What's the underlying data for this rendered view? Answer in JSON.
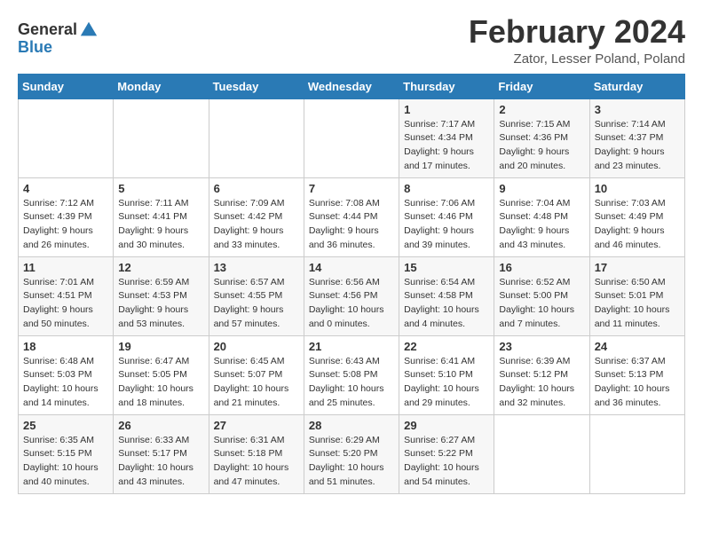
{
  "header": {
    "logo_general": "General",
    "logo_blue": "Blue",
    "title": "February 2024",
    "location": "Zator, Lesser Poland, Poland"
  },
  "days_of_week": [
    "Sunday",
    "Monday",
    "Tuesday",
    "Wednesday",
    "Thursday",
    "Friday",
    "Saturday"
  ],
  "weeks": [
    [
      {
        "day": "",
        "detail": ""
      },
      {
        "day": "",
        "detail": ""
      },
      {
        "day": "",
        "detail": ""
      },
      {
        "day": "",
        "detail": ""
      },
      {
        "day": "1",
        "detail": "Sunrise: 7:17 AM\nSunset: 4:34 PM\nDaylight: 9 hours\nand 17 minutes."
      },
      {
        "day": "2",
        "detail": "Sunrise: 7:15 AM\nSunset: 4:36 PM\nDaylight: 9 hours\nand 20 minutes."
      },
      {
        "day": "3",
        "detail": "Sunrise: 7:14 AM\nSunset: 4:37 PM\nDaylight: 9 hours\nand 23 minutes."
      }
    ],
    [
      {
        "day": "4",
        "detail": "Sunrise: 7:12 AM\nSunset: 4:39 PM\nDaylight: 9 hours\nand 26 minutes."
      },
      {
        "day": "5",
        "detail": "Sunrise: 7:11 AM\nSunset: 4:41 PM\nDaylight: 9 hours\nand 30 minutes."
      },
      {
        "day": "6",
        "detail": "Sunrise: 7:09 AM\nSunset: 4:42 PM\nDaylight: 9 hours\nand 33 minutes."
      },
      {
        "day": "7",
        "detail": "Sunrise: 7:08 AM\nSunset: 4:44 PM\nDaylight: 9 hours\nand 36 minutes."
      },
      {
        "day": "8",
        "detail": "Sunrise: 7:06 AM\nSunset: 4:46 PM\nDaylight: 9 hours\nand 39 minutes."
      },
      {
        "day": "9",
        "detail": "Sunrise: 7:04 AM\nSunset: 4:48 PM\nDaylight: 9 hours\nand 43 minutes."
      },
      {
        "day": "10",
        "detail": "Sunrise: 7:03 AM\nSunset: 4:49 PM\nDaylight: 9 hours\nand 46 minutes."
      }
    ],
    [
      {
        "day": "11",
        "detail": "Sunrise: 7:01 AM\nSunset: 4:51 PM\nDaylight: 9 hours\nand 50 minutes."
      },
      {
        "day": "12",
        "detail": "Sunrise: 6:59 AM\nSunset: 4:53 PM\nDaylight: 9 hours\nand 53 minutes."
      },
      {
        "day": "13",
        "detail": "Sunrise: 6:57 AM\nSunset: 4:55 PM\nDaylight: 9 hours\nand 57 minutes."
      },
      {
        "day": "14",
        "detail": "Sunrise: 6:56 AM\nSunset: 4:56 PM\nDaylight: 10 hours\nand 0 minutes."
      },
      {
        "day": "15",
        "detail": "Sunrise: 6:54 AM\nSunset: 4:58 PM\nDaylight: 10 hours\nand 4 minutes."
      },
      {
        "day": "16",
        "detail": "Sunrise: 6:52 AM\nSunset: 5:00 PM\nDaylight: 10 hours\nand 7 minutes."
      },
      {
        "day": "17",
        "detail": "Sunrise: 6:50 AM\nSunset: 5:01 PM\nDaylight: 10 hours\nand 11 minutes."
      }
    ],
    [
      {
        "day": "18",
        "detail": "Sunrise: 6:48 AM\nSunset: 5:03 PM\nDaylight: 10 hours\nand 14 minutes."
      },
      {
        "day": "19",
        "detail": "Sunrise: 6:47 AM\nSunset: 5:05 PM\nDaylight: 10 hours\nand 18 minutes."
      },
      {
        "day": "20",
        "detail": "Sunrise: 6:45 AM\nSunset: 5:07 PM\nDaylight: 10 hours\nand 21 minutes."
      },
      {
        "day": "21",
        "detail": "Sunrise: 6:43 AM\nSunset: 5:08 PM\nDaylight: 10 hours\nand 25 minutes."
      },
      {
        "day": "22",
        "detail": "Sunrise: 6:41 AM\nSunset: 5:10 PM\nDaylight: 10 hours\nand 29 minutes."
      },
      {
        "day": "23",
        "detail": "Sunrise: 6:39 AM\nSunset: 5:12 PM\nDaylight: 10 hours\nand 32 minutes."
      },
      {
        "day": "24",
        "detail": "Sunrise: 6:37 AM\nSunset: 5:13 PM\nDaylight: 10 hours\nand 36 minutes."
      }
    ],
    [
      {
        "day": "25",
        "detail": "Sunrise: 6:35 AM\nSunset: 5:15 PM\nDaylight: 10 hours\nand 40 minutes."
      },
      {
        "day": "26",
        "detail": "Sunrise: 6:33 AM\nSunset: 5:17 PM\nDaylight: 10 hours\nand 43 minutes."
      },
      {
        "day": "27",
        "detail": "Sunrise: 6:31 AM\nSunset: 5:18 PM\nDaylight: 10 hours\nand 47 minutes."
      },
      {
        "day": "28",
        "detail": "Sunrise: 6:29 AM\nSunset: 5:20 PM\nDaylight: 10 hours\nand 51 minutes."
      },
      {
        "day": "29",
        "detail": "Sunrise: 6:27 AM\nSunset: 5:22 PM\nDaylight: 10 hours\nand 54 minutes."
      },
      {
        "day": "",
        "detail": ""
      },
      {
        "day": "",
        "detail": ""
      }
    ]
  ]
}
